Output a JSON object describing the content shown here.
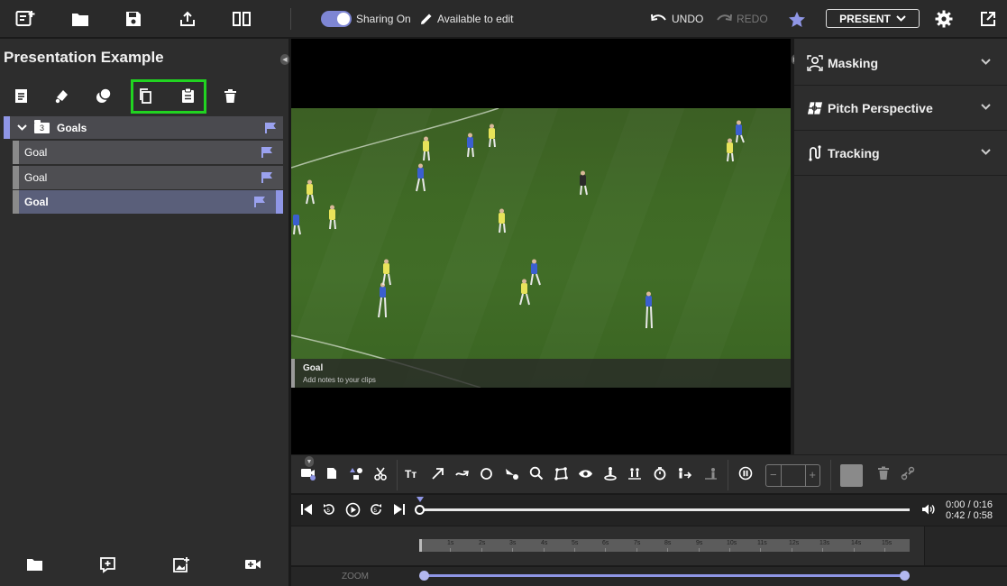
{
  "topbar": {
    "sharing_label": "Sharing On",
    "edit_label": "Available to edit",
    "undo_label": "UNDO",
    "redo_label": "REDO",
    "present_label": "PRESENT",
    "accent": "#8f96e6"
  },
  "presentation": {
    "title": "Presentation Example",
    "group": {
      "label": "Goals",
      "count": "3"
    },
    "clips": [
      {
        "label": "Goal"
      },
      {
        "label": "Goal"
      },
      {
        "label": "Goal"
      }
    ]
  },
  "video": {
    "caption_title": "Goal",
    "caption_subtitle": "Add notes to your clips"
  },
  "right_panel": {
    "sections": [
      {
        "label": "Masking"
      },
      {
        "label": "Pitch Perspective"
      },
      {
        "label": "Tracking"
      }
    ]
  },
  "playback": {
    "time_clip": "0:00 / 0:16",
    "time_total": "0:42 / 0:58"
  },
  "timeline": {
    "ticks": [
      "1s",
      "2s",
      "3s",
      "4s",
      "5s",
      "6s",
      "7s",
      "8s",
      "9s",
      "10s",
      "11s",
      "12s",
      "13s",
      "14s",
      "15s"
    ]
  },
  "zoom": {
    "label": "ZOOM"
  }
}
